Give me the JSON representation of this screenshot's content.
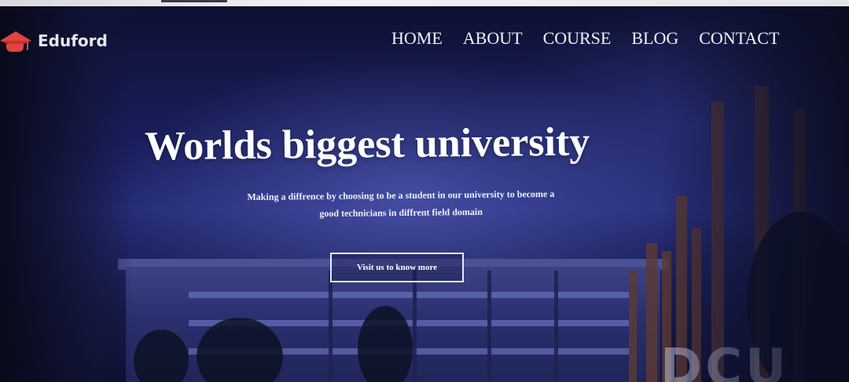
{
  "brand": {
    "name": "Eduford",
    "icon": "graduation-cap-icon",
    "accent": "#e0443f"
  },
  "nav": {
    "items": [
      {
        "label": "HOME"
      },
      {
        "label": "ABOUT"
      },
      {
        "label": "COURSE"
      },
      {
        "label": "BLOG"
      },
      {
        "label": "CONTACT"
      }
    ]
  },
  "hero": {
    "title": "Worlds biggest university",
    "subtitle_line1": "Making a diffrence by choosing to be a student in our university to become a",
    "subtitle_line2": "good technicians in diffrent field domain",
    "cta_label": "Visit us to know more"
  },
  "colors": {
    "background": "#1a1f5e",
    "text": "#ffffff"
  }
}
